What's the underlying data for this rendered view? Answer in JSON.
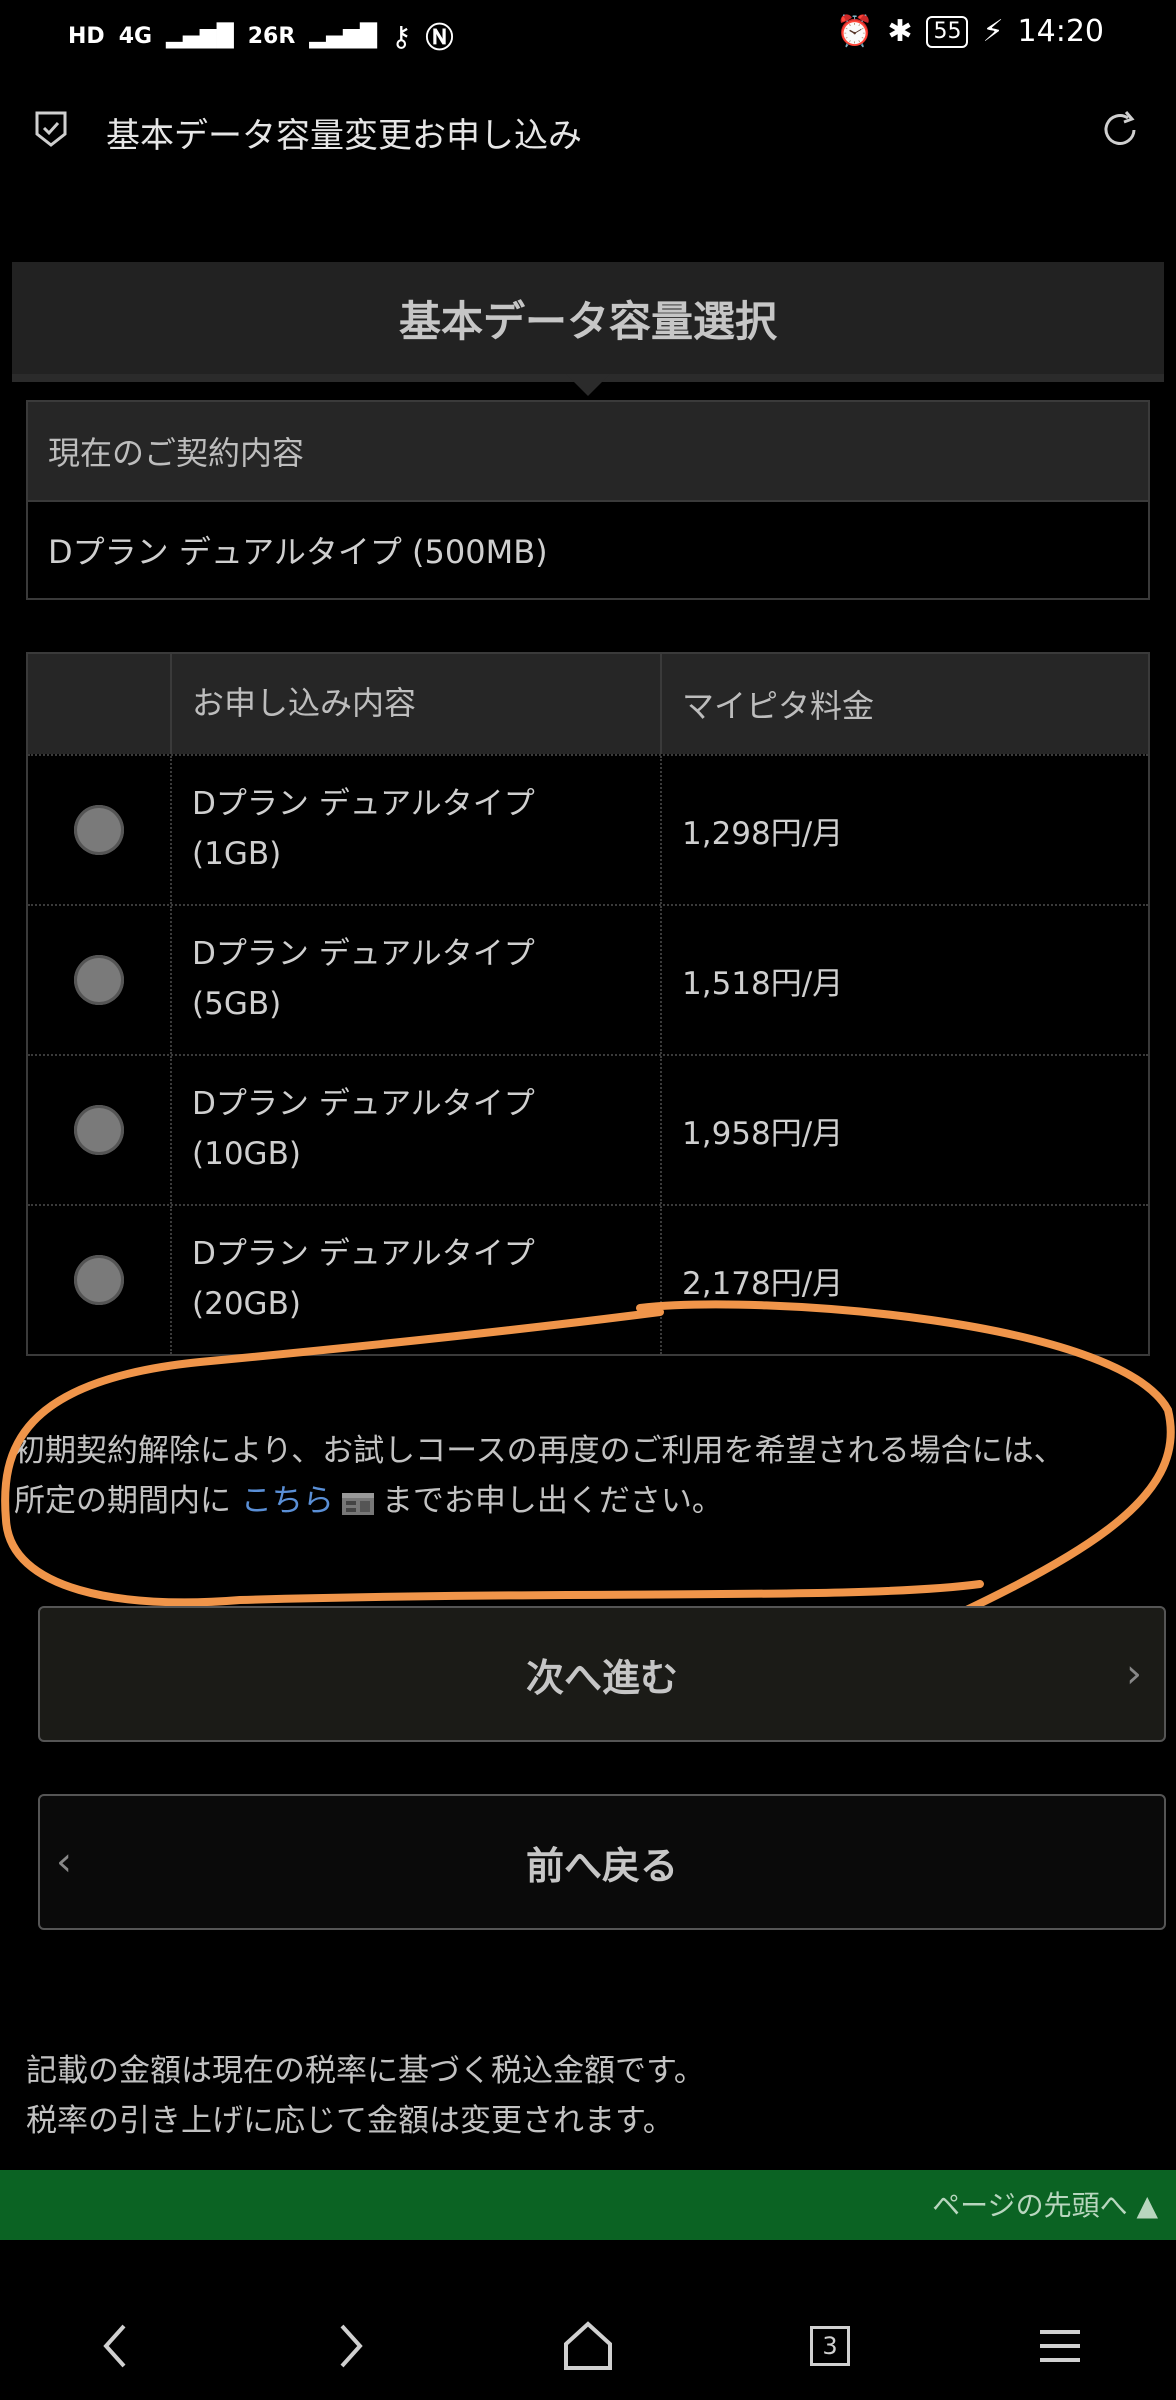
{
  "status_bar": {
    "left_indicators": [
      "HD",
      "4G",
      "26R"
    ],
    "battery": "55",
    "time": "14:20"
  },
  "titlebar": {
    "title": "基本データ容量変更お申し込み"
  },
  "section": {
    "heading": "基本データ容量選択"
  },
  "current_contract": {
    "label": "現在のご契約内容",
    "value": "Dプラン デュアルタイプ (500MB)"
  },
  "plan_table": {
    "headers": [
      "",
      "お申し込み内容",
      "マイピタ料金"
    ],
    "rows": [
      {
        "plan_line1": "Dプラン デュアルタイプ",
        "plan_line2": "(1GB)",
        "price": "1,298円/月"
      },
      {
        "plan_line1": "Dプラン デュアルタイプ",
        "plan_line2": "(5GB)",
        "price": "1,518円/月"
      },
      {
        "plan_line1": "Dプラン デュアルタイプ",
        "plan_line2": "(10GB)",
        "price": "1,958円/月"
      },
      {
        "plan_line1": "Dプラン デュアルタイプ",
        "plan_line2": "(20GB)",
        "price": "2,178円/月"
      }
    ]
  },
  "notice": {
    "line1": "初期契約解除により、お試しコースの再度のご利用を希望される場合には、",
    "line2_before": "所定の期間内に",
    "link": "こちら",
    "line2_after": "までお申し出ください。"
  },
  "buttons": {
    "next": "次へ進む",
    "prev": "前へ戻る"
  },
  "footer": {
    "line1": "記載の金額は現在の税率に基づく税込金額です。",
    "line2": "税率の引き上げに応じて金額は変更されます。",
    "page_top": "ページの先頭へ ▲"
  },
  "nav": {
    "tab_count": "3"
  },
  "colors": {
    "annotation": "#f0954a",
    "link": "#5a8fd6",
    "page_top_bar": "#0b6323"
  }
}
